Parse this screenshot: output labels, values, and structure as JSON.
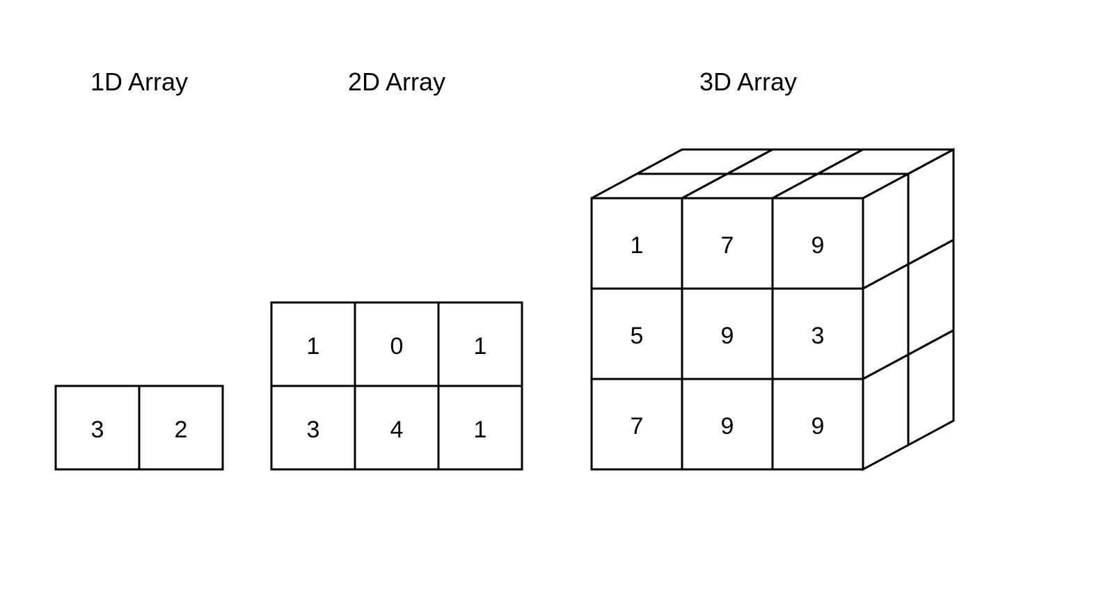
{
  "titles": {
    "d1": "1D Array",
    "d2": "2D Array",
    "d3": "3D Array"
  },
  "d1": {
    "values": [
      "3",
      "2"
    ]
  },
  "d2": {
    "rows": [
      [
        "1",
        "0",
        "1"
      ],
      [
        "3",
        "4",
        "1"
      ]
    ]
  },
  "d3": {
    "front": [
      [
        "1",
        "7",
        "9"
      ],
      [
        "5",
        "9",
        "3"
      ],
      [
        "7",
        "9",
        "9"
      ]
    ]
  },
  "chart_data": {
    "type": "table",
    "arrays": [
      {
        "name": "1D Array",
        "shape": [
          2
        ],
        "data": [
          3,
          2
        ]
      },
      {
        "name": "2D Array",
        "shape": [
          2,
          3
        ],
        "data": [
          [
            1,
            0,
            1
          ],
          [
            3,
            4,
            1
          ]
        ]
      },
      {
        "name": "3D Array",
        "shape": [
          3,
          3,
          2
        ],
        "front_face": [
          [
            1,
            7,
            9
          ],
          [
            5,
            9,
            3
          ],
          [
            7,
            9,
            9
          ]
        ]
      }
    ]
  }
}
